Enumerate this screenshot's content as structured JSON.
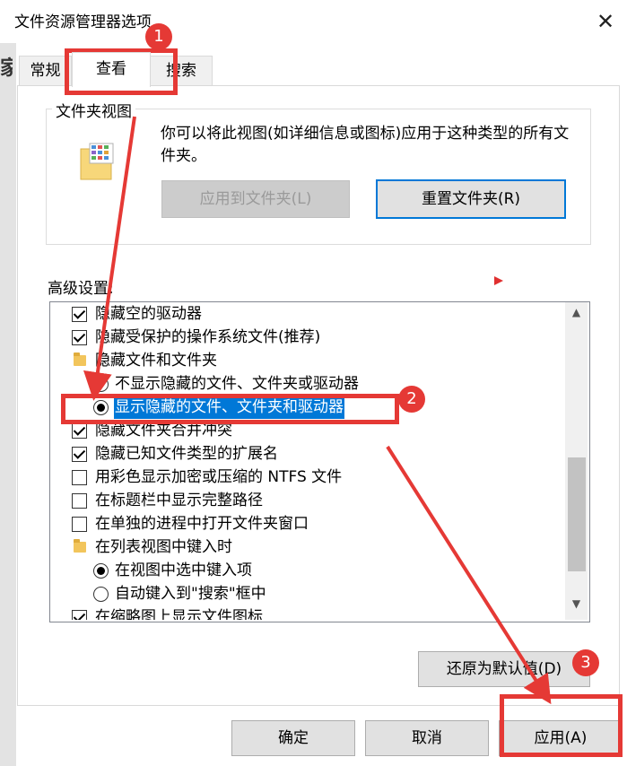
{
  "window": {
    "title": "文件资源管理器选项",
    "close_glyph": "✕"
  },
  "background_glyph": "家",
  "tabs": [
    {
      "label": "常规"
    },
    {
      "label": "查看"
    },
    {
      "label": "搜索"
    }
  ],
  "folder_view": {
    "label": "文件夹视图",
    "description": "你可以将此视图(如详细信息或图标)应用于这种类型的所有文件夹。",
    "apply_button": "应用到文件夹(L)",
    "reset_button": "重置文件夹(R)"
  },
  "advanced": {
    "label": "高级设置:",
    "items": [
      {
        "type": "checkbox",
        "checked": true,
        "label": "隐藏空的驱动器"
      },
      {
        "type": "checkbox",
        "checked": true,
        "label": "隐藏受保护的操作系统文件(推荐)"
      },
      {
        "type": "folder",
        "label": "隐藏文件和文件夹"
      },
      {
        "type": "radio",
        "checked": false,
        "label": "不显示隐藏的文件、文件夹或驱动器"
      },
      {
        "type": "radio",
        "checked": true,
        "selected": true,
        "label": "显示隐藏的文件、文件夹和驱动器"
      },
      {
        "type": "checkbox",
        "checked": true,
        "label": "隐藏文件夹合并冲突"
      },
      {
        "type": "checkbox",
        "checked": true,
        "label": "隐藏已知文件类型的扩展名"
      },
      {
        "type": "checkbox",
        "checked": false,
        "label": "用彩色显示加密或压缩的 NTFS 文件"
      },
      {
        "type": "checkbox",
        "checked": false,
        "label": "在标题栏中显示完整路径"
      },
      {
        "type": "checkbox",
        "checked": false,
        "label": "在单独的进程中打开文件夹窗口"
      },
      {
        "type": "folder",
        "label": "在列表视图中键入时"
      },
      {
        "type": "radio",
        "checked": true,
        "label": "在视图中选中键入项"
      },
      {
        "type": "radio",
        "checked": false,
        "label": "自动键入到\"搜索\"框中"
      },
      {
        "type": "checkbox",
        "checked": true,
        "label": "在缩略图上显示文件图标"
      }
    ],
    "restore_button": "还原为默认值(D)"
  },
  "footer": {
    "ok": "确定",
    "cancel": "取消",
    "apply": "应用(A)"
  },
  "annotations": {
    "step1": "1",
    "step2": "2",
    "step3": "3",
    "color": "#e53935"
  },
  "colors": {
    "accent": "#0078d7",
    "annotation_red": "#e53935"
  }
}
